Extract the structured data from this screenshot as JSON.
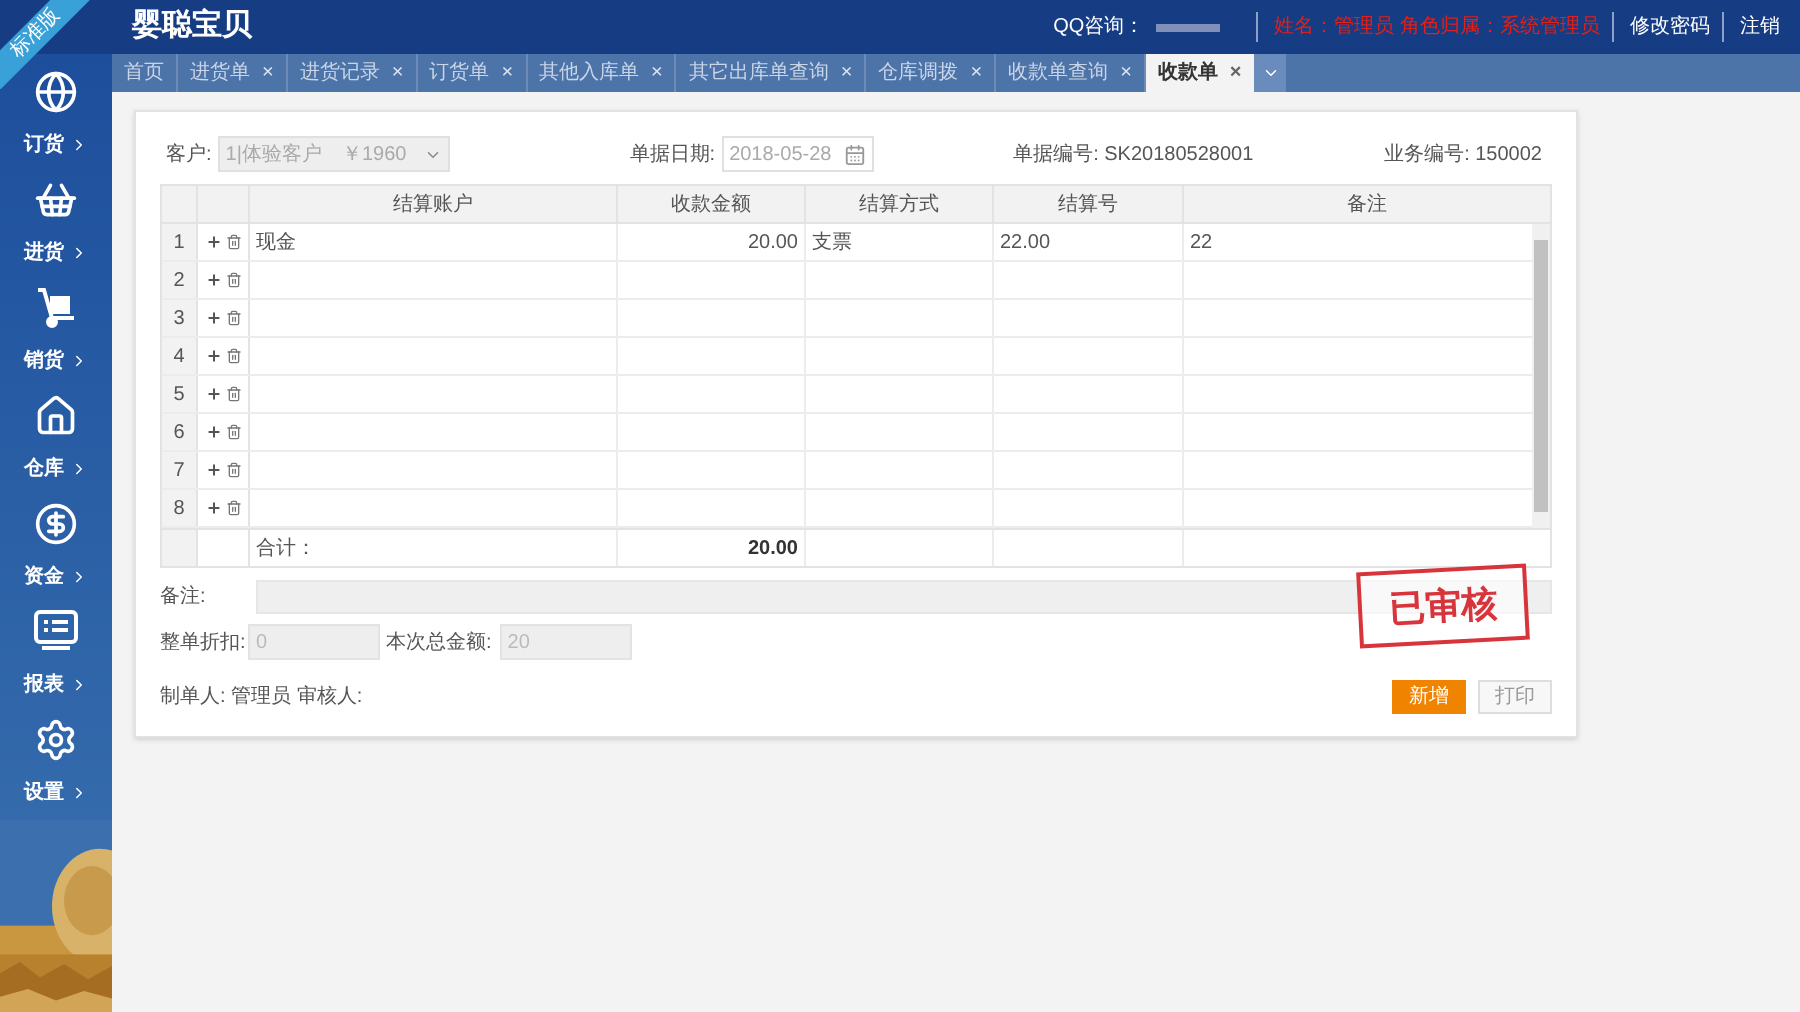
{
  "ribbon": {
    "text": "标准版"
  },
  "header": {
    "logo": "婴聪宝贝",
    "qq_label": "QQ咨询：",
    "user_info": "姓名：管理员 角色归属：系统管理员",
    "links": [
      "修改密码",
      "注销"
    ]
  },
  "sidebar": {
    "items": [
      {
        "label": "订货",
        "kind": "globe"
      },
      {
        "label": "进货",
        "kind": "basket"
      },
      {
        "label": "销货",
        "kind": "truck"
      },
      {
        "label": "仓库",
        "kind": "home"
      },
      {
        "label": "资金",
        "kind": "dollar"
      },
      {
        "label": "报表",
        "kind": "report"
      },
      {
        "label": "设置",
        "kind": "gear"
      }
    ]
  },
  "tabs": [
    {
      "label": "首页",
      "selected": false
    },
    {
      "label": "进货单",
      "close": "×",
      "selected": false
    },
    {
      "label": "进货记录",
      "close": "×",
      "selected": false
    },
    {
      "label": "订货单",
      "close": "×",
      "selected": false
    },
    {
      "label": "其他入库单",
      "close": "×",
      "selected": false
    },
    {
      "label": "其它出库单查询",
      "close": "×",
      "selected": false
    },
    {
      "label": "仓库调拨",
      "close": "×",
      "selected": false
    },
    {
      "label": "收款单查询",
      "close": "×",
      "selected": false
    },
    {
      "label": "收款单",
      "close": "×",
      "selected": true
    }
  ],
  "form": {
    "customer_label": "客户:",
    "customer_value": "1|体验客户　￥1960",
    "date_label": "单据日期:",
    "date_value": "2018-05-28",
    "doc_no": "单据编号: SK20180528001",
    "biz_no": "业务编号: 150002"
  },
  "table": {
    "columns": [
      "结算账户",
      "收款金额",
      "结算方式",
      "结算号",
      "备注"
    ],
    "rows": [
      {
        "no": "1",
        "cells": [
          "现金",
          "20.00",
          "支票",
          "22.00",
          "22"
        ]
      },
      {
        "no": "2",
        "cells": []
      },
      {
        "no": "3",
        "cells": []
      },
      {
        "no": "4",
        "cells": []
      },
      {
        "no": "5",
        "cells": []
      },
      {
        "no": "6",
        "cells": []
      },
      {
        "no": "7",
        "cells": []
      },
      {
        "no": "8",
        "cells": []
      }
    ],
    "total_label": "合计：",
    "total_amount": "20.00"
  },
  "remark_label": "备注:",
  "discount_label": "整单折扣:",
  "discount_value": "0",
  "total_label": "本次总金额:",
  "total_value": "20",
  "makers": "制单人: 管理员 审核人:",
  "stamp": "已审核",
  "buttons": [
    {
      "label": "新增",
      "kind": "primary"
    },
    {
      "label": "打印",
      "kind": "secondary"
    }
  ]
}
